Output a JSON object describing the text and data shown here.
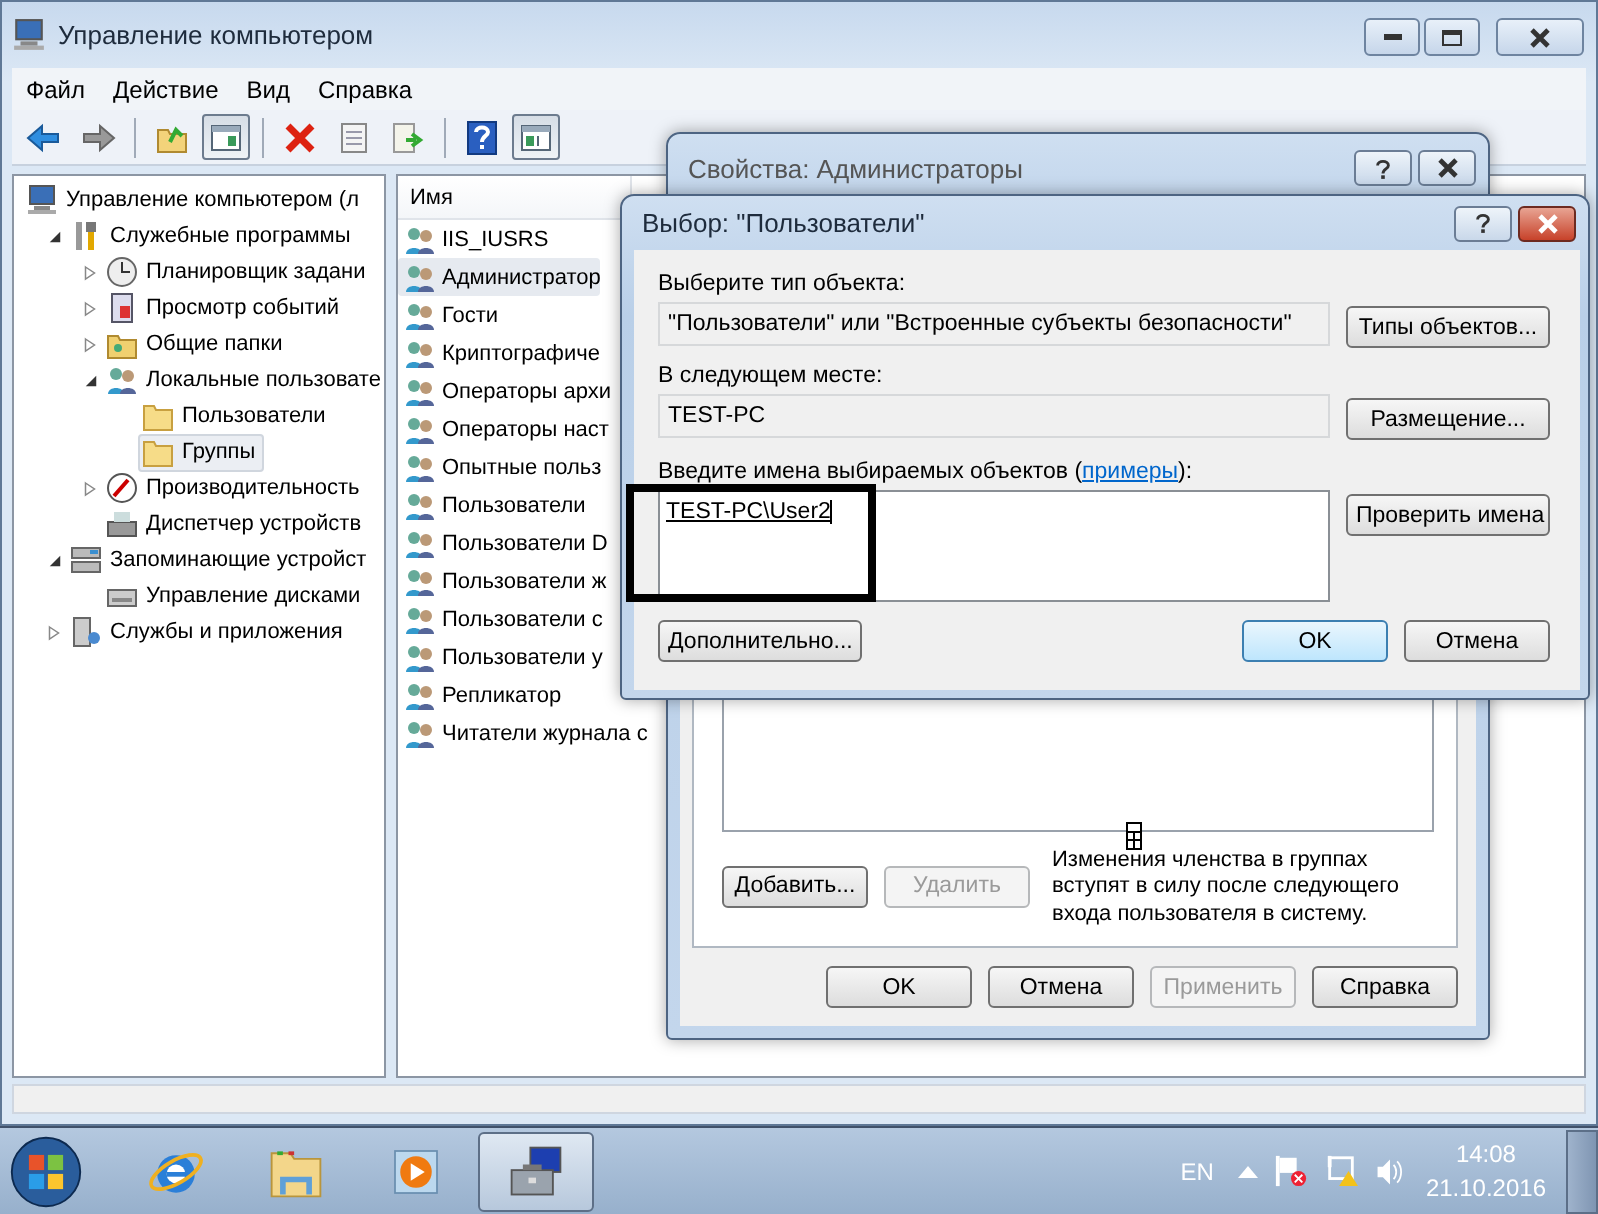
{
  "window": {
    "title": "Управление компьютером"
  },
  "menu": [
    {
      "label": "Файл"
    },
    {
      "label": "Действие"
    },
    {
      "label": "Вид"
    },
    {
      "label": "Справка"
    }
  ],
  "toolbar": [
    {
      "kind": "back",
      "pressed": false
    },
    {
      "kind": "forward",
      "pressed": false
    },
    {
      "kind": "separator"
    },
    {
      "kind": "up",
      "pressed": false
    },
    {
      "kind": "tree-toggle",
      "pressed": true
    },
    {
      "kind": "separator"
    },
    {
      "kind": "delete",
      "pressed": false
    },
    {
      "kind": "properties",
      "pressed": false
    },
    {
      "kind": "export",
      "pressed": false
    },
    {
      "kind": "separator"
    },
    {
      "kind": "help",
      "pressed": false
    },
    {
      "kind": "action-pane",
      "pressed": true
    }
  ],
  "tree": [
    {
      "label": "Управление компьютером (л",
      "kind": "computer",
      "selected": false,
      "children": [
        {
          "label": "Служебные программы",
          "kind": "tools",
          "expanded": true,
          "selected": false,
          "children": [
            {
              "label": "Планировщик задани",
              "kind": "clock",
              "expanded": false,
              "selected": false
            },
            {
              "label": "Просмотр событий",
              "kind": "log",
              "expanded": false,
              "selected": false
            },
            {
              "label": "Общие папки",
              "kind": "share",
              "expanded": false,
              "selected": false
            },
            {
              "label": "Локальные пользовате",
              "kind": "users",
              "expanded": true,
              "selected": false,
              "children": [
                {
                  "label": "Пользователи",
                  "kind": "folder",
                  "selected": false
                },
                {
                  "label": "Группы",
                  "kind": "folder",
                  "selected": true
                }
              ]
            },
            {
              "label": "Производительность",
              "kind": "gauge",
              "expanded": false,
              "selected": false
            },
            {
              "label": "Диспетчер устройств",
              "kind": "device",
              "selected": false
            }
          ]
        },
        {
          "label": "Запоминающие устройст",
          "kind": "storage",
          "expanded": true,
          "selected": false,
          "children": [
            {
              "label": "Управление дисками",
              "kind": "drive",
              "selected": false
            }
          ]
        },
        {
          "label": "Службы и приложения",
          "kind": "server",
          "expanded": false,
          "selected": false
        }
      ]
    }
  ],
  "list": {
    "column": "Имя",
    "items": [
      {
        "name": "IIS_IUSRS",
        "selected": false
      },
      {
        "name": "Администратор",
        "selected": true
      },
      {
        "name": "Гости",
        "selected": false
      },
      {
        "name": "Криптографиче",
        "selected": false
      },
      {
        "name": "Операторы архи",
        "selected": false
      },
      {
        "name": "Операторы наст",
        "selected": false
      },
      {
        "name": "Опытные польз",
        "selected": false
      },
      {
        "name": "Пользователи",
        "selected": false
      },
      {
        "name": "Пользователи D",
        "selected": false
      },
      {
        "name": "Пользователи ж",
        "selected": false
      },
      {
        "name": "Пользователи с",
        "selected": false
      },
      {
        "name": "Пользователи у",
        "selected": false
      },
      {
        "name": "Репликатор",
        "selected": false
      },
      {
        "name": "Читатели журнала с",
        "selected": false
      }
    ]
  },
  "properties_dialog": {
    "title": "Свойства: Администраторы",
    "member_buttons": [
      {
        "label": "Добавить...",
        "disabled": false
      },
      {
        "label": "Удалить",
        "disabled": true
      }
    ],
    "note": "Изменения членства в группах вступят в силу после следующего входа пользователя в систему.",
    "buttons": [
      {
        "label": "OK",
        "disabled": false
      },
      {
        "label": "Отмена",
        "disabled": false
      },
      {
        "label": "Применить",
        "disabled": true
      },
      {
        "label": "Справка",
        "disabled": false
      }
    ]
  },
  "select_dialog": {
    "title": "Выбор: \"Пользователи\"",
    "object_type": {
      "label": "Выберите тип объекта:",
      "value": "\"Пользователи\" или \"Встроенные субъекты безопасности\"",
      "button": "Типы объектов..."
    },
    "location": {
      "label": "В следующем месте:",
      "value": "TEST-PC",
      "button": "Размещение..."
    },
    "names": {
      "label_before": "Введите имена выбираемых объектов (",
      "link": "примеры",
      "label_after": "):",
      "value": "TEST-PC\\User2",
      "button": "Проверить имена"
    },
    "advanced_button": "Дополнительно...",
    "buttons": [
      {
        "label": "OK",
        "default": true
      },
      {
        "label": "Отмена",
        "default": false
      }
    ]
  },
  "taskbar": {
    "apps": [
      {
        "kind": "browser",
        "active": false
      },
      {
        "kind": "explorer",
        "active": false
      },
      {
        "kind": "media",
        "active": false
      },
      {
        "kind": "management",
        "active": true
      }
    ],
    "language": "EN",
    "time": "14:08",
    "date": "21.10.2016"
  }
}
